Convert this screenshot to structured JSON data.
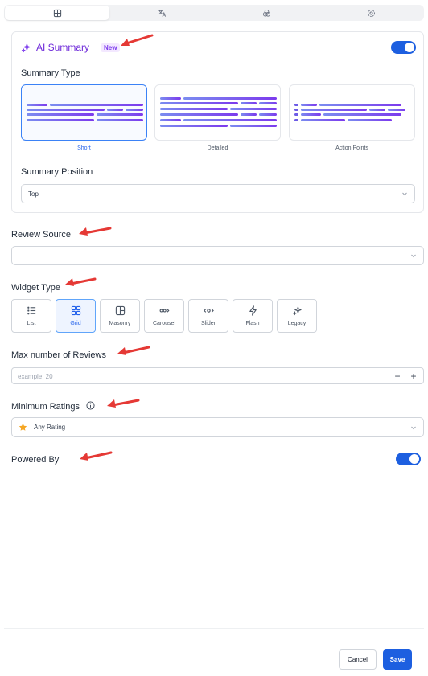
{
  "tabs": [
    {
      "name": "layout",
      "icon": "grid-icon",
      "active": true
    },
    {
      "name": "translate",
      "icon": "translate-icon",
      "active": false
    },
    {
      "name": "styles",
      "icon": "circles-icon",
      "active": false
    },
    {
      "name": "settings",
      "icon": "gear-icon",
      "active": false
    }
  ],
  "ai_summary": {
    "title": "AI Summary",
    "badge": "New",
    "enabled": true,
    "summary_type_label": "Summary Type",
    "types": [
      {
        "label": "Short",
        "selected": true
      },
      {
        "label": "Detailed",
        "selected": false
      },
      {
        "label": "Action Points",
        "selected": false
      }
    ],
    "position_label": "Summary Position",
    "position_value": "Top"
  },
  "review_source": {
    "label": "Review Source",
    "value": ""
  },
  "widget_type": {
    "label": "Widget Type",
    "options": [
      {
        "label": "List",
        "icon": "list-icon",
        "selected": false
      },
      {
        "label": "Grid",
        "icon": "grid-icon",
        "selected": true
      },
      {
        "label": "Masonry",
        "icon": "masonry-icon",
        "selected": false
      },
      {
        "label": "Carousel",
        "icon": "carousel-icon",
        "selected": false
      },
      {
        "label": "Slider",
        "icon": "slider-icon",
        "selected": false
      },
      {
        "label": "Flash",
        "icon": "flash-icon",
        "selected": false
      },
      {
        "label": "Legacy",
        "icon": "sparkle-icon",
        "selected": false
      }
    ]
  },
  "max_reviews": {
    "label": "Max number of Reviews",
    "placeholder": "example: 20",
    "decrement": "−",
    "increment": "+"
  },
  "min_ratings": {
    "label": "Minimum Ratings",
    "value": "Any Rating"
  },
  "powered_by": {
    "label": "Powered By",
    "enabled": true
  },
  "footer": {
    "cancel": "Cancel",
    "save": "Save"
  },
  "colors": {
    "accent": "#1d5fe0",
    "purple": "#6d28d9",
    "annotation_arrow": "#e53935"
  }
}
